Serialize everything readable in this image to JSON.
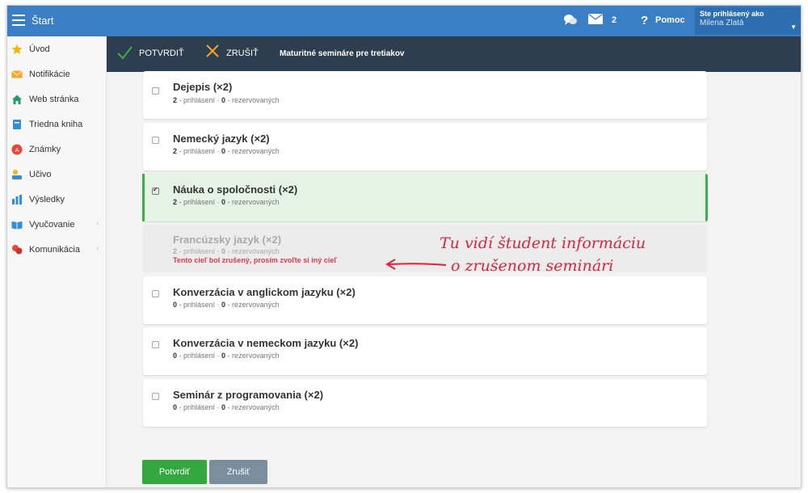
{
  "topbar": {
    "title": "Štart",
    "mail_count": "2",
    "help_label": "Pomoc",
    "help_symbol": "?",
    "user_label": "Ste prihlásený ako",
    "user_name": "Milena Zlatá"
  },
  "sidebar": {
    "items": [
      {
        "label": "Úvod",
        "icon": "star-icon",
        "color": "#f5b800"
      },
      {
        "label": "Notifikácie",
        "icon": "envelope-icon",
        "color": "#f5a623"
      },
      {
        "label": "Web stránka",
        "icon": "home-icon",
        "color": "#1e9e6e"
      },
      {
        "label": "Triedna kniha",
        "icon": "book-icon",
        "color": "#2f8fd8"
      },
      {
        "label": "Známky",
        "icon": "grade-icon",
        "color": "#e8453c"
      },
      {
        "label": "Učivo",
        "icon": "learning-icon",
        "color": "#2f8fd8"
      },
      {
        "label": "Výsledky",
        "icon": "bar-chart-icon",
        "color": "#2f8fd8"
      },
      {
        "label": "Vyučovanie",
        "icon": "open-book-icon",
        "color": "#2f8fd8"
      },
      {
        "label": "Komunikácia",
        "icon": "people-icon",
        "color": "#e8453c"
      }
    ]
  },
  "actionbar": {
    "confirm_label": "POTVRDIŤ",
    "cancel_label": "ZRUŠIŤ",
    "title": "Maturitné semináre pre tretiakov"
  },
  "seminars": [
    {
      "name": "Dejepis (×2)",
      "registered": "2",
      "reserved": "0",
      "checked": false,
      "state": "normal"
    },
    {
      "name": "Nemecký jazyk (×2)",
      "registered": "2",
      "reserved": "0",
      "checked": false,
      "state": "normal"
    },
    {
      "name": "Náuka o spoločnosti (×2)",
      "registered": "2",
      "reserved": "0",
      "checked": true,
      "state": "selected"
    },
    {
      "name": "Francúzsky jazyk (×2)",
      "registered": "2",
      "reserved": "0",
      "checked": false,
      "state": "cancelled"
    },
    {
      "name": "Konverzácia v anglickom jazyku (×2)",
      "registered": "0",
      "reserved": "0",
      "checked": false,
      "state": "normal"
    },
    {
      "name": "Konverzácia v nemeckom jazyku (×2)",
      "registered": "0",
      "reserved": "0",
      "checked": false,
      "state": "normal"
    },
    {
      "name": "Seminár z programovania (×2)",
      "registered": "0",
      "reserved": "0",
      "checked": false,
      "state": "normal"
    }
  ],
  "labels": {
    "registered_suffix": " - prihlásení · ",
    "reserved_suffix": " - rezervovaných",
    "cancelled_message": "Tento cieľ bol zrušený, prosím zvoľte si iný cieľ"
  },
  "annotation": {
    "line1": "Tu vidí študent informáciu",
    "line2": "o zrušenom seminári"
  },
  "buttons": {
    "confirm": "Potvrdiť",
    "cancel": "Zrušiť"
  },
  "colors": {
    "topbar": "#3a7fc5",
    "actionbar": "#2c3e50",
    "selected_bg": "#e4f3e4",
    "selected_border": "#3fae49",
    "cancel_text": "#e2394b",
    "confirm_button": "#34a83f",
    "cancel_button": "#7b8e9e"
  }
}
